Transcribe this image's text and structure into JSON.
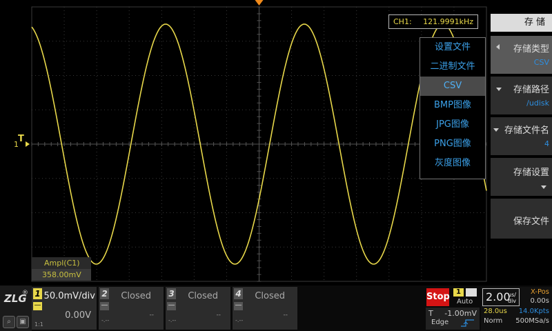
{
  "colors": {
    "trace": "#e8d84a",
    "grid": "#3a3a3a",
    "accent_blue": "#2d8ee0",
    "stop_red": "#d41414",
    "trigger_marker": "#f08a1a"
  },
  "readout": {
    "channel": "CH1:",
    "frequency": "121.9991kHz"
  },
  "measurement": {
    "label": "Ampl(C1)",
    "value": "358.00mV"
  },
  "markers": {
    "trigger_level": "T",
    "channel_ref": "1"
  },
  "waveform": {
    "cycles_visible": 3.1,
    "frequency_khz": 121.9991,
    "amplitude_mv": 358.0
  },
  "dropdown": {
    "items": [
      {
        "label": "设置文件",
        "selected": false
      },
      {
        "label": "二进制文件",
        "selected": false
      },
      {
        "label": "CSV",
        "selected": true
      },
      {
        "label": "BMP图像",
        "selected": false
      },
      {
        "label": "JPG图像",
        "selected": false
      },
      {
        "label": "PNG图像",
        "selected": false
      },
      {
        "label": "灰度图像",
        "selected": false
      }
    ]
  },
  "menu": {
    "title": "存 储",
    "items": [
      {
        "label": "存储类型",
        "value": "CSV",
        "arrow": "left"
      },
      {
        "label": "存储路径",
        "value": "/udisk",
        "arrow": "down"
      },
      {
        "label": "存储文件名",
        "value": "4",
        "arrow": "down"
      },
      {
        "label": "存储设置",
        "value": "",
        "arrow": ""
      },
      {
        "label": "保存文件",
        "value": "",
        "arrow": ""
      }
    ]
  },
  "logo": {
    "text": "ZLG",
    "reg": "®",
    "ratio": "1:1"
  },
  "channels": [
    {
      "num": "1",
      "state": "50.0mV/div",
      "offset": "0.00V",
      "small_left": "",
      "small_right": ""
    },
    {
      "num": "2",
      "state": "Closed",
      "offset": "",
      "small_left": "-.--",
      "small_right": "--"
    },
    {
      "num": "3",
      "state": "Closed",
      "offset": "",
      "small_left": "-.--",
      "small_right": "--"
    },
    {
      "num": "4",
      "state": "Closed",
      "offset": "",
      "small_left": "-.--",
      "small_right": "--"
    }
  ],
  "trigger": {
    "status": "Stop",
    "source": "1",
    "mode": "Auto",
    "t_label": "T",
    "level": "-1.00mV",
    "type": "Edge"
  },
  "timebase": {
    "scale": "2.00",
    "unit_top": "us/",
    "unit_bottom": "div",
    "xpos_label": "X-Pos",
    "xpos_value": "0.00s",
    "delay": "28.0us",
    "points": "14.0Kpts",
    "acq_mode": "Norm",
    "sample_rate": "500MSa/s"
  }
}
